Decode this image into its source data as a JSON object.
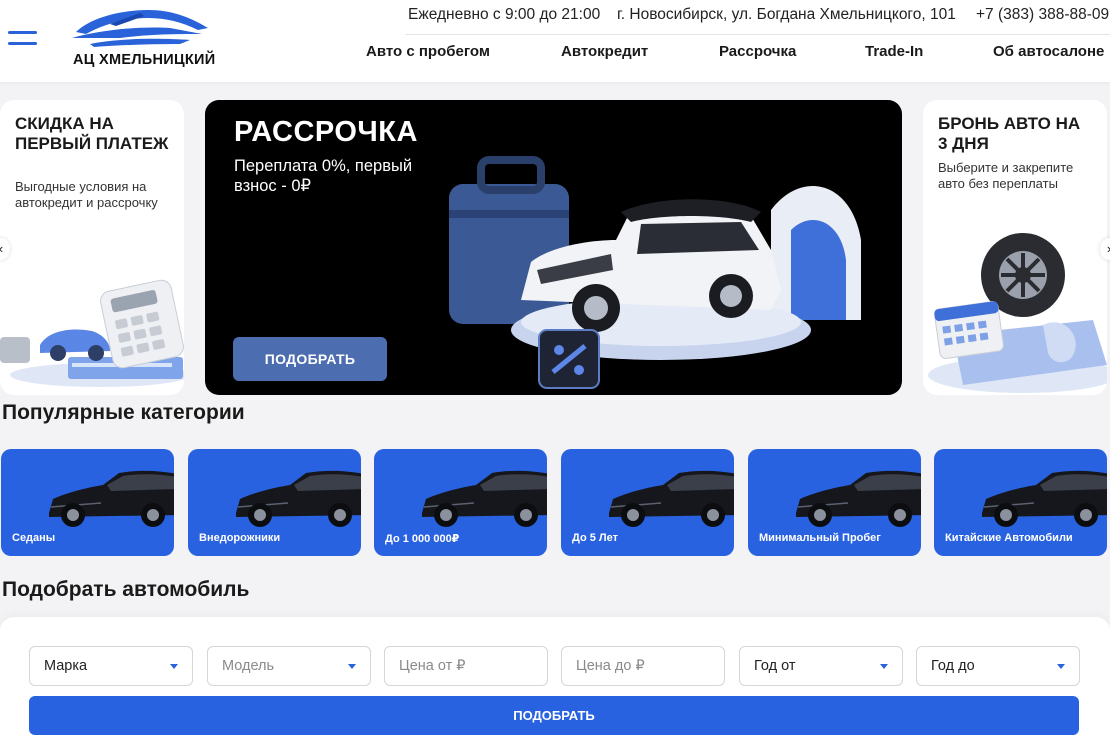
{
  "brand": {
    "logo_text": "АЦ ХМЕЛЬНИЦКИЙ"
  },
  "header": {
    "hours": "Ежедневно с 9:00 до 21:00",
    "address": "г. Новосибирск, ул. Богдана Хмельницкого, 101",
    "phone": "+7 (383) 388-88-09",
    "nav": [
      "Авто с пробегом",
      "Автокредит",
      "Рассрочка",
      "Trade-In",
      "Об автосалоне"
    ]
  },
  "banners": {
    "left": {
      "title": "Скидка на первый платеж",
      "text": "Выгодные условия на автокредит и рассрочку"
    },
    "main": {
      "title": "РАССРОЧКА",
      "subtitle": "Переплата 0%, первый взнос - 0₽",
      "button": "ПОДОБРАТЬ"
    },
    "right": {
      "title": "Бронь авто на 3 дня",
      "text": "Выберите и закрепите авто без переплаты"
    }
  },
  "categories": {
    "title": "Популярные категории",
    "items": [
      "Седаны",
      "Внедорожники",
      "До 1 000 000₽",
      "До 5 Лет",
      "Минимальный Пробег",
      "Китайские Автомобили"
    ]
  },
  "filter": {
    "title": "Подобрать автомобиль",
    "brand": "Марка",
    "model": "Модель",
    "price_from_placeholder": "Цена от ₽",
    "price_to_placeholder": "Цена до ₽",
    "year_from": "Год от",
    "year_to": "Год до",
    "submit": "ПОДОБРАТЬ"
  },
  "colors": {
    "accent": "#2962e0",
    "banner_button": "#4c6db0"
  }
}
